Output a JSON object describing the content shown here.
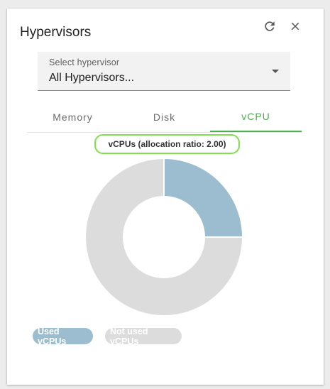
{
  "header": {
    "title": "Hypervisors",
    "refresh_icon": "refresh-icon",
    "close_icon": "close-icon"
  },
  "select": {
    "label": "Select hypervisor",
    "value": "All Hypervisors..."
  },
  "tabs": [
    {
      "label": "Memory",
      "active": false
    },
    {
      "label": "Disk",
      "active": false
    },
    {
      "label": "vCPU",
      "active": true
    }
  ],
  "colors": {
    "accent": "#4caf50",
    "used": "#9bbdcf",
    "not_used": "#dcdcdc",
    "highlight": "#7ee04e"
  },
  "chart_data": {
    "type": "pie",
    "title": "vCPUs (allocation ratio: 2.00)",
    "donut": true,
    "series": [
      {
        "name": "Used vCPUs",
        "value": 25,
        "color": "#9bbdcf"
      },
      {
        "name": "Not used vCPUs",
        "value": 75,
        "color": "#dcdcdc"
      }
    ],
    "legend_position": "bottom-left"
  }
}
